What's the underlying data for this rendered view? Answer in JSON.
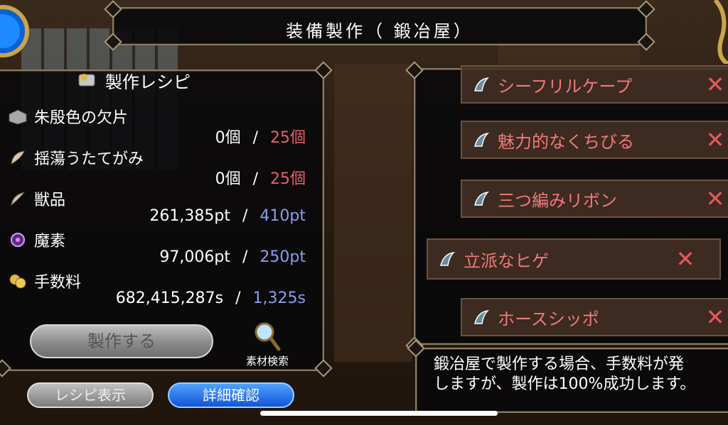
{
  "title": "装備製作（ 鍛冶屋）",
  "recipe": {
    "header": "製作レシピ",
    "materials": [
      {
        "name": "朱殷色の欠片",
        "have": "0個",
        "need": "25個",
        "icon": "stone-icon"
      },
      {
        "name": "揺蕩うたてがみ",
        "have": "0個",
        "need": "25個",
        "icon": "feather-icon"
      },
      {
        "name": "獣品",
        "have": "261,385pt",
        "need": "410pt",
        "icon": "claw-icon"
      },
      {
        "name": "魔素",
        "have": "97,006pt",
        "need": "250pt",
        "icon": "orb-icon"
      },
      {
        "name": "手数料",
        "have": "682,415,287s",
        "need": "1,325s",
        "icon": "coins-icon"
      }
    ],
    "separator": "/"
  },
  "buttons": {
    "make": "製作する",
    "search": "素材検索",
    "recipe_view": "レシピ表示",
    "detail": "詳細確認"
  },
  "list": {
    "items": [
      {
        "label": "シーフリルケープ"
      },
      {
        "label": "魅力的なくちびる"
      },
      {
        "label": "三つ編みリボン"
      },
      {
        "label": "立派なヒゲ"
      },
      {
        "label": "ホースシッポ"
      }
    ],
    "remove_symbol": "✕"
  },
  "info": {
    "line1": "鍛冶屋で製作する場合、手数料が発",
    "line2": "しますが、製作は100%成功します。"
  },
  "colors": {
    "shortfall": "#e8606a",
    "requirement_pt": "#8c9cf0",
    "list_text": "#f07a7a",
    "detail_button": "#1e6cf0"
  }
}
